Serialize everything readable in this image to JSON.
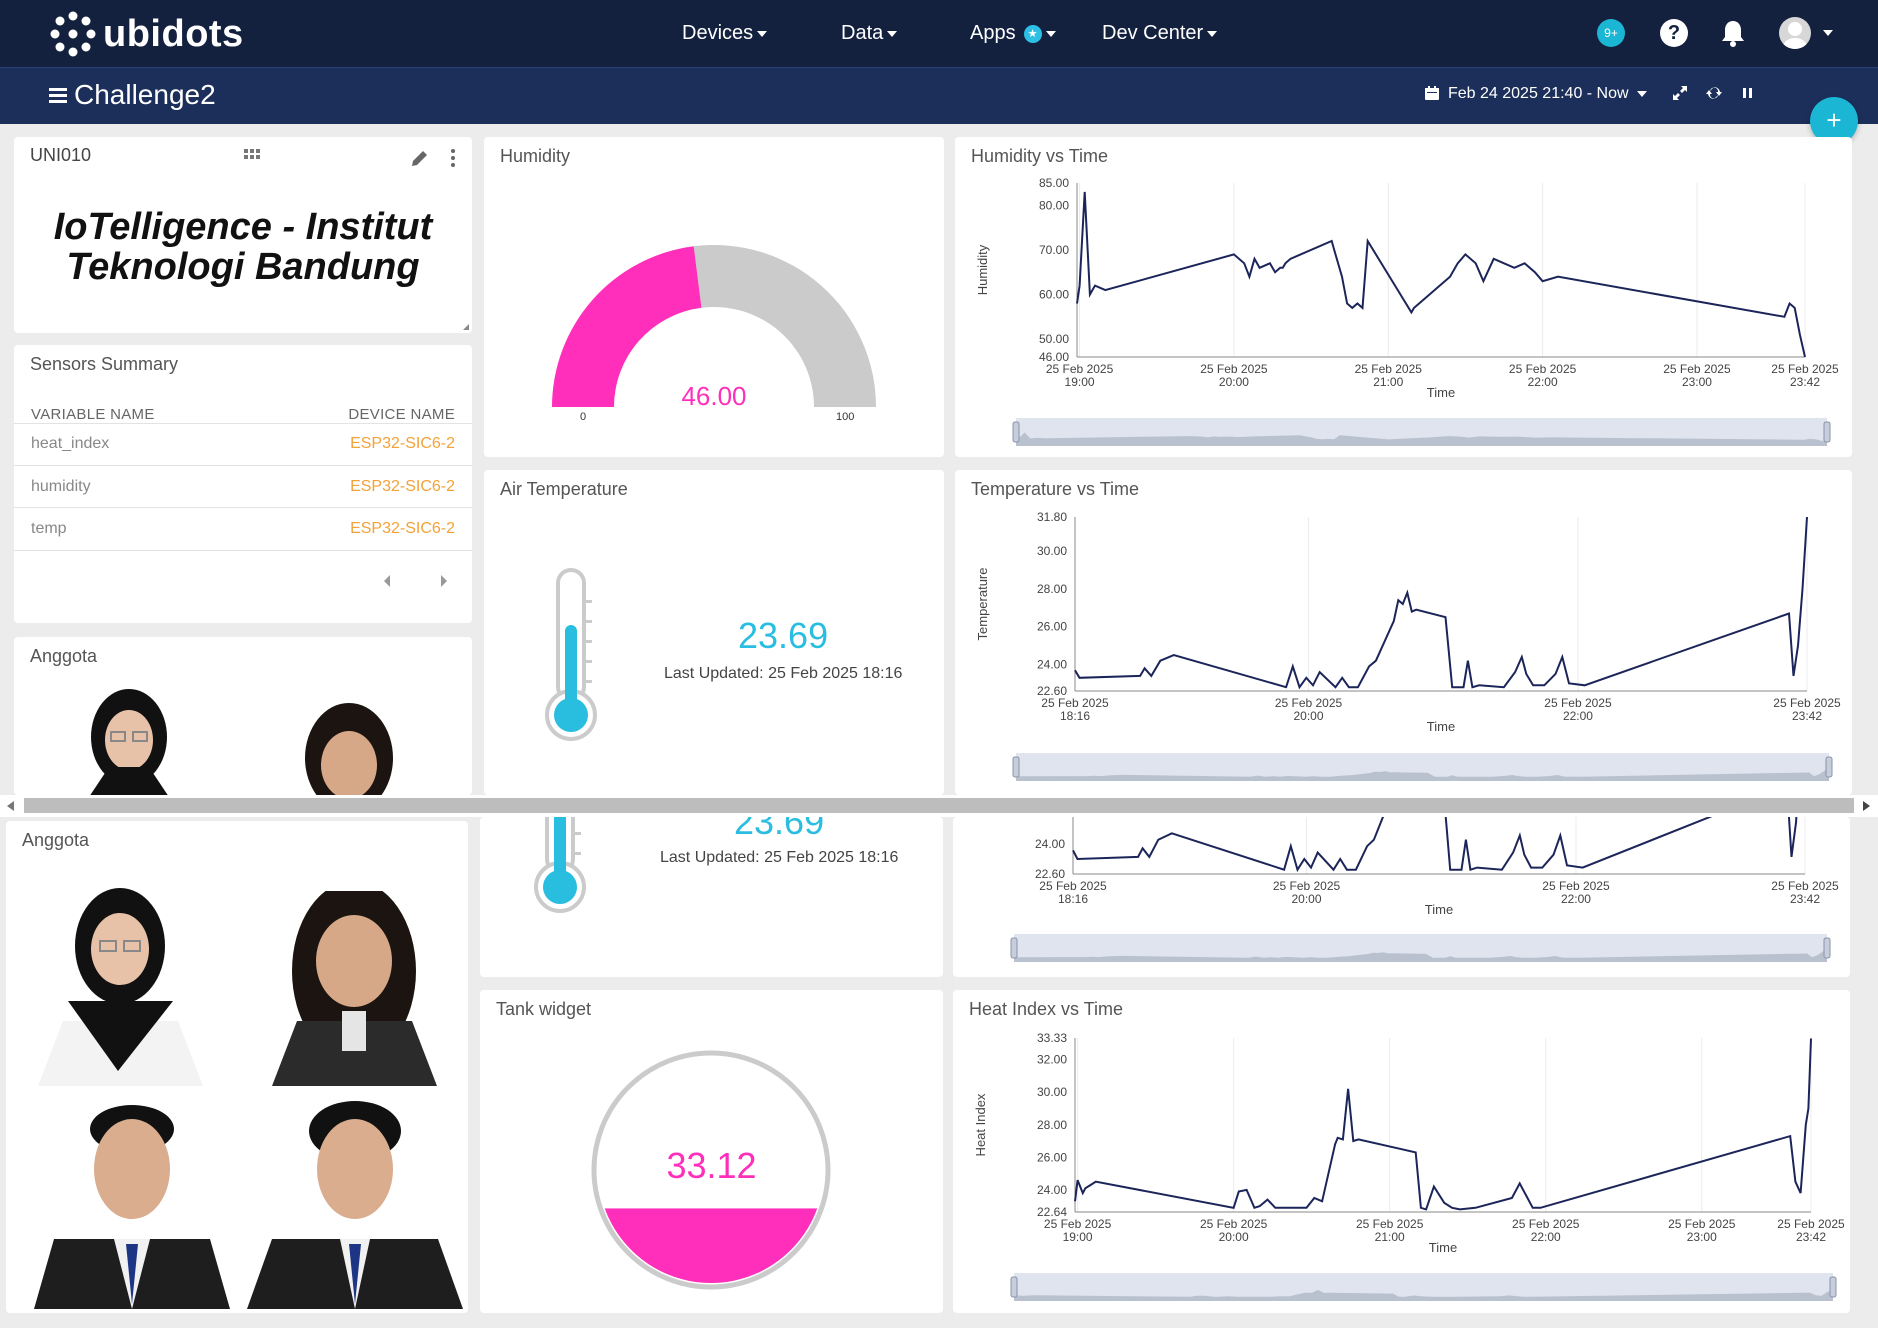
{
  "app": {
    "logo_text": "ubidots"
  },
  "nav": {
    "items": [
      {
        "label": "Devices"
      },
      {
        "label": "Data"
      },
      {
        "label": "Apps"
      },
      {
        "label": "Dev Center"
      }
    ],
    "notifications_badge": "9+",
    "help_glyph": "?"
  },
  "subbar": {
    "dashboard_title": "Challenge2",
    "date_range": "Feb 24 2025 21:40 - Now",
    "fab_label": "+"
  },
  "widgets": {
    "title_card": {
      "id": "UNI010",
      "headline_line1": "IoTelligence - Institut",
      "headline_line2": "Teknologi Bandung"
    },
    "sensors_summary": {
      "title": "Sensors Summary",
      "col_variable": "VARIABLE NAME",
      "col_device": "DEVICE NAME",
      "rows": [
        {
          "variable": "heat_index",
          "device": "ESP32-SIC6-2"
        },
        {
          "variable": "humidity",
          "device": "ESP32-SIC6-2"
        },
        {
          "variable": "temp",
          "device": "ESP32-SIC6-2"
        }
      ]
    },
    "anggota_top": {
      "title": "Anggota"
    },
    "anggota_bottom": {
      "title": "Anggota"
    },
    "humidity_gauge": {
      "title": "Humidity",
      "value": "46.00",
      "fraction": 0.46,
      "min_label": "0",
      "max_label": "100"
    },
    "air_temperature": {
      "title": "Air Temperature",
      "value": "23.69",
      "last_updated": "Last Updated: 25 Feb 2025 18:16"
    },
    "air_temperature_dup": {
      "value": "23.69",
      "last_updated": "Last Updated: 25 Feb 2025 18:16"
    },
    "tank": {
      "title": "Tank widget",
      "value": "33.12",
      "fill_fraction": 0.33
    },
    "humidity_chart_title": "Humidity vs Time",
    "temp_chart_title": "Temperature vs Time",
    "heat_chart_title": "Heat Index vs Time"
  },
  "colors": {
    "topbar": "#13213f",
    "subbar": "#1c2f5b",
    "accent_cyan": "#1bb6d3",
    "gauge_fill": "#ff2fbb",
    "line": "#1c2559",
    "device_orange": "#f3a238"
  },
  "icons": [
    "grid-icon",
    "pencil-icon",
    "kebab-icon",
    "calendar-icon",
    "caret-down-icon",
    "expand-icon",
    "refresh-icon",
    "pause-icon",
    "bell-icon",
    "help-icon",
    "avatar-icon",
    "hamburger-icon",
    "chevron-left-icon",
    "chevron-right-icon",
    "thermometer-icon"
  ],
  "chart_data": [
    {
      "type": "line",
      "title": "Humidity vs Time",
      "xlabel": "Time",
      "ylabel": "Humidity",
      "ylim": [
        46.0,
        85.0
      ],
      "y_ticks": [
        "46.00",
        "50.00",
        "60.00",
        "70.00",
        "80.00",
        "85.00"
      ],
      "x_ticks": [
        {
          "l1": "25 Feb 2025",
          "l2": "19:00"
        },
        {
          "l1": "25 Feb 2025",
          "l2": "20:00"
        },
        {
          "l1": "25 Feb 2025",
          "l2": "21:00"
        },
        {
          "l1": "25 Feb 2025",
          "l2": "22:00"
        },
        {
          "l1": "25 Feb 2025",
          "l2": "23:00"
        },
        {
          "l1": "25 Feb 2025",
          "l2": "23:42"
        }
      ],
      "x": [
        "18:59",
        "19:00",
        "19:02",
        "19:04",
        "19:06",
        "19:10",
        "20:00",
        "20:04",
        "20:06",
        "20:08",
        "20:10",
        "20:14",
        "20:16",
        "20:18",
        "20:19",
        "20:20",
        "20:22",
        "20:38",
        "20:39",
        "20:42",
        "20:44",
        "20:46",
        "20:48",
        "20:50",
        "20:52",
        "21:09",
        "21:10",
        "21:12",
        "21:24",
        "21:27",
        "21:30",
        "21:34",
        "21:37",
        "21:41",
        "21:45",
        "21:49",
        "21:53",
        "21:57",
        "22:00",
        "22:06",
        "23:34",
        "23:36",
        "23:38",
        "23:40",
        "23:42"
      ],
      "values": [
        58,
        62,
        83,
        60,
        62,
        61,
        69,
        67,
        64,
        68,
        66,
        67,
        65,
        66,
        66,
        67,
        68,
        72,
        70,
        64,
        58,
        57,
        58,
        57,
        72,
        56,
        57,
        58,
        64,
        67,
        69,
        67,
        63,
        68,
        67,
        66,
        67,
        65,
        63,
        64,
        55,
        58,
        57,
        51,
        46
      ]
    },
    {
      "type": "line",
      "title": "Temperature vs Time",
      "xlabel": "Time",
      "ylabel": "Temperature",
      "ylim": [
        22.6,
        31.8
      ],
      "y_ticks": [
        "22.60",
        "24.00",
        "26.00",
        "28.00",
        "30.00",
        "31.80"
      ],
      "x_ticks": [
        {
          "l1": "25 Feb 2025",
          "l2": "18:16"
        },
        {
          "l1": "25 Feb 2025",
          "l2": "20:00"
        },
        {
          "l1": "25 Feb 2025",
          "l2": "22:00"
        },
        {
          "l1": "25 Feb 2025",
          "l2": "23:42"
        }
      ],
      "x": [
        "18:16",
        "18:18",
        "18:45",
        "18:47",
        "18:50",
        "18:54",
        "19:00",
        "19:50",
        "19:53",
        "19:56",
        "19:59",
        "20:02",
        "20:05",
        "20:12",
        "20:15",
        "20:18",
        "20:22",
        "20:27",
        "20:30",
        "20:38",
        "20:40",
        "20:42",
        "20:44",
        "20:46",
        "20:48",
        "21:01",
        "21:04",
        "21:09",
        "21:11",
        "21:13",
        "21:16",
        "21:27",
        "21:32",
        "21:35",
        "21:37",
        "21:40",
        "21:45",
        "21:50",
        "21:53",
        "21:56",
        "22:03",
        "23:34",
        "23:36",
        "23:38",
        "23:40",
        "23:42"
      ],
      "values": [
        23.7,
        23.3,
        23.4,
        23.8,
        23.4,
        24.2,
        24.5,
        22.8,
        23.9,
        22.8,
        23.3,
        22.9,
        23.6,
        22.8,
        23.3,
        22.8,
        22.8,
        23.9,
        24.2,
        26.3,
        27.4,
        27.2,
        27.8,
        26.8,
        26.9,
        26.5,
        22.8,
        22.8,
        24.2,
        22.8,
        22.9,
        22.8,
        23.6,
        24.4,
        23.5,
        22.9,
        22.9,
        23.5,
        24.4,
        23.0,
        22.9,
        26.7,
        23.4,
        25.0,
        28.0,
        31.8
      ]
    },
    {
      "type": "line",
      "title": "Heat Index vs Time",
      "xlabel": "Time",
      "ylabel": "Heat Index",
      "ylim": [
        22.64,
        33.33
      ],
      "y_ticks": [
        "22.64",
        "24.00",
        "26.00",
        "28.00",
        "30.00",
        "32.00",
        "33.33"
      ],
      "x_ticks": [
        {
          "l1": "25 Feb 2025",
          "l2": "19:00"
        },
        {
          "l1": "25 Feb 2025",
          "l2": "20:00"
        },
        {
          "l1": "25 Feb 2025",
          "l2": "21:00"
        },
        {
          "l1": "25 Feb 2025",
          "l2": "22:00"
        },
        {
          "l1": "25 Feb 2025",
          "l2": "23:00"
        },
        {
          "l1": "25 Feb 2025",
          "l2": "23:42"
        }
      ],
      "x": [
        "18:59",
        "19:00",
        "19:02",
        "19:03",
        "19:05",
        "19:07",
        "20:00",
        "20:02",
        "20:05",
        "20:08",
        "20:10",
        "20:13",
        "20:16",
        "20:28",
        "20:31",
        "20:34",
        "20:39",
        "20:40",
        "20:42",
        "20:44",
        "20:46",
        "20:48",
        "21:10",
        "21:12",
        "21:14",
        "21:17",
        "21:21",
        "21:24",
        "21:27",
        "21:33",
        "21:47",
        "21:50",
        "21:53",
        "21:55",
        "21:58",
        "23:34",
        "23:36",
        "23:38",
        "23:40",
        "23:41",
        "23:42"
      ],
      "values": [
        23.3,
        24.6,
        23.8,
        24.1,
        24.3,
        24.5,
        22.9,
        23.9,
        24.0,
        22.9,
        23.0,
        23.4,
        22.9,
        22.9,
        23.5,
        23.3,
        26.8,
        27.2,
        27.1,
        30.2,
        27.0,
        27.1,
        26.3,
        22.9,
        22.8,
        24.2,
        23.2,
        22.9,
        22.8,
        22.9,
        23.5,
        24.4,
        23.5,
        22.9,
        22.9,
        27.3,
        24.5,
        23.8,
        28.0,
        29.0,
        33.3
      ]
    }
  ]
}
